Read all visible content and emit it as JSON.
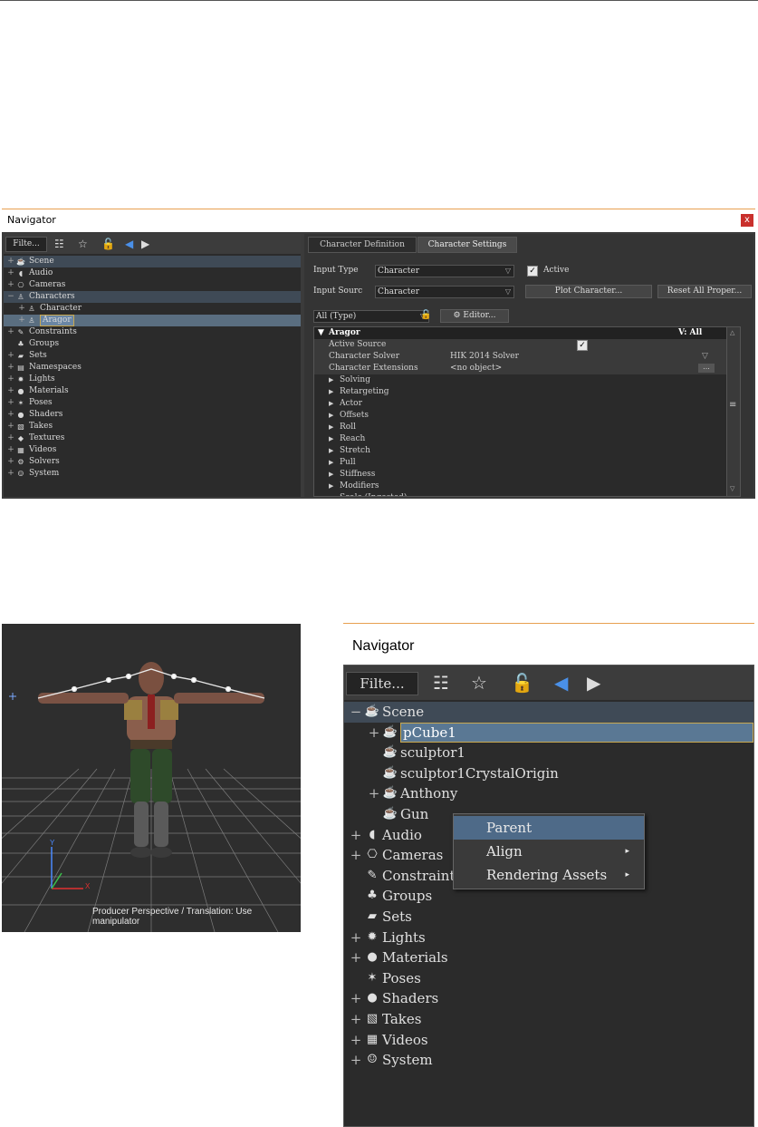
{
  "colors": {
    "panel_dark": "#2b2b2b",
    "selection": "#5a6e80",
    "title_accent": "#e8a050",
    "close_red": "#c9302c"
  },
  "nav1": {
    "title": "Navigator",
    "close_label": "x",
    "filter_label": "Filte...",
    "tree": [
      {
        "label": "Scene",
        "icon": "teapot-icon",
        "glyph": "☕",
        "expand": "+"
      },
      {
        "label": "Audio",
        "icon": "audio-icon",
        "glyph": "◖",
        "expand": "+"
      },
      {
        "label": "Cameras",
        "icon": "camera-icon",
        "glyph": "⎔",
        "expand": "+"
      },
      {
        "label": "Characters",
        "icon": "character-icon",
        "glyph": "♙",
        "expand": "−"
      },
      {
        "label": "Character",
        "icon": "character-icon",
        "glyph": "♙",
        "expand": "+"
      },
      {
        "label": "Aragor",
        "icon": "character-icon",
        "glyph": "♙",
        "expand": "+"
      },
      {
        "label": "Constraints",
        "icon": "constraint-icon",
        "glyph": "✎",
        "expand": "+"
      },
      {
        "label": "Groups",
        "icon": "groups-icon",
        "glyph": "♣",
        "expand": ""
      },
      {
        "label": "Sets",
        "icon": "folder-icon",
        "glyph": "▰",
        "expand": "+"
      },
      {
        "label": "Namespaces",
        "icon": "namespace-icon",
        "glyph": "▤",
        "expand": "+"
      },
      {
        "label": "Lights",
        "icon": "light-icon",
        "glyph": "✹",
        "expand": "+"
      },
      {
        "label": "Materials",
        "icon": "material-icon",
        "glyph": "●",
        "expand": "+"
      },
      {
        "label": "Poses",
        "icon": "pose-icon",
        "glyph": "✶",
        "expand": "+"
      },
      {
        "label": "Shaders",
        "icon": "shader-icon",
        "glyph": "●",
        "expand": "+"
      },
      {
        "label": "Takes",
        "icon": "take-icon",
        "glyph": "▧",
        "expand": "+"
      },
      {
        "label": "Textures",
        "icon": "texture-icon",
        "glyph": "◆",
        "expand": "+"
      },
      {
        "label": "Videos",
        "icon": "video-icon",
        "glyph": "▦",
        "expand": "+"
      },
      {
        "label": "Solvers",
        "icon": "solver-icon",
        "glyph": "⚙",
        "expand": "+"
      },
      {
        "label": "System",
        "icon": "system-icon",
        "glyph": "☺",
        "expand": "+"
      }
    ],
    "tabs": [
      "Character Definition",
      "Character Settings"
    ],
    "input_type_label": "Input Type",
    "input_type_value": "Character",
    "active_label": "Active",
    "input_source_label": "Input Sourc",
    "input_source_value": "Character",
    "plot_button": "Plot Character...",
    "reset_button": "Reset All Proper...",
    "filter_combo": "All (Type)",
    "editor_button": "Editor...",
    "grid_header": "Aragor",
    "grid_header_right": "V: All",
    "props": [
      {
        "name": "Active Source",
        "value": ""
      },
      {
        "name": "Character Solver",
        "value": "HIK 2014 Solver"
      },
      {
        "name": "Character Extensions",
        "value": "<no object>"
      }
    ],
    "groups": [
      "Solving",
      "Retargeting",
      "Actor",
      "Offsets",
      "Roll",
      "Reach",
      "Stretch",
      "Pull",
      "Stiffness",
      "Modifiers"
    ],
    "cut_off_row": "Scale (Ingested)"
  },
  "viewport": {
    "label": "Producer Perspective / Translation: Use manipulator"
  },
  "nav2": {
    "title": "Navigator",
    "filter_label": "Filte...",
    "tree": [
      {
        "label": "Scene",
        "icon": "teapot-icon",
        "glyph": "☕",
        "expand": "−",
        "indent": 0
      },
      {
        "label": "pCube1",
        "icon": "teapot-icon",
        "glyph": "☕",
        "expand": "+",
        "indent": 1
      },
      {
        "label": "sculptor1",
        "icon": "teapot-icon",
        "glyph": "☕",
        "expand": "",
        "indent": 1
      },
      {
        "label": "sculptor1CrystalOrigin",
        "icon": "teapot-icon",
        "glyph": "☕",
        "expand": "",
        "indent": 1
      },
      {
        "label": "Anthony",
        "icon": "teapot-icon",
        "glyph": "☕",
        "expand": "+",
        "indent": 1
      },
      {
        "label": "Gun",
        "icon": "teapot-icon",
        "glyph": "☕",
        "expand": "",
        "indent": 1
      },
      {
        "label": "Audio",
        "icon": "audio-icon",
        "glyph": "◖",
        "expand": "+",
        "indent": 0
      },
      {
        "label": "Cameras",
        "icon": "camera-icon",
        "glyph": "⎔",
        "expand": "+",
        "indent": 0
      },
      {
        "label": "Constraints",
        "icon": "constraint-icon",
        "glyph": "✎",
        "expand": "",
        "indent": 0
      },
      {
        "label": "Groups",
        "icon": "groups-icon",
        "glyph": "♣",
        "expand": "",
        "indent": 0
      },
      {
        "label": "Sets",
        "icon": "folder-icon",
        "glyph": "▰",
        "expand": "",
        "indent": 0
      },
      {
        "label": "Lights",
        "icon": "light-icon",
        "glyph": "✹",
        "expand": "+",
        "indent": 0
      },
      {
        "label": "Materials",
        "icon": "material-icon",
        "glyph": "●",
        "expand": "+",
        "indent": 0
      },
      {
        "label": "Poses",
        "icon": "pose-icon",
        "glyph": "✶",
        "expand": "",
        "indent": 0
      },
      {
        "label": "Shaders",
        "icon": "shader-icon",
        "glyph": "●",
        "expand": "+",
        "indent": 0
      },
      {
        "label": "Takes",
        "icon": "take-icon",
        "glyph": "▧",
        "expand": "+",
        "indent": 0
      },
      {
        "label": "Videos",
        "icon": "video-icon",
        "glyph": "▦",
        "expand": "+",
        "indent": 0
      },
      {
        "label": "System",
        "icon": "system-icon",
        "glyph": "☺",
        "expand": "+",
        "indent": 0
      }
    ],
    "context_menu": [
      {
        "label": "Parent",
        "submenu": ""
      },
      {
        "label": "Align",
        "submenu": "▸"
      },
      {
        "label": "Rendering Assets",
        "submenu": "▸"
      }
    ]
  }
}
